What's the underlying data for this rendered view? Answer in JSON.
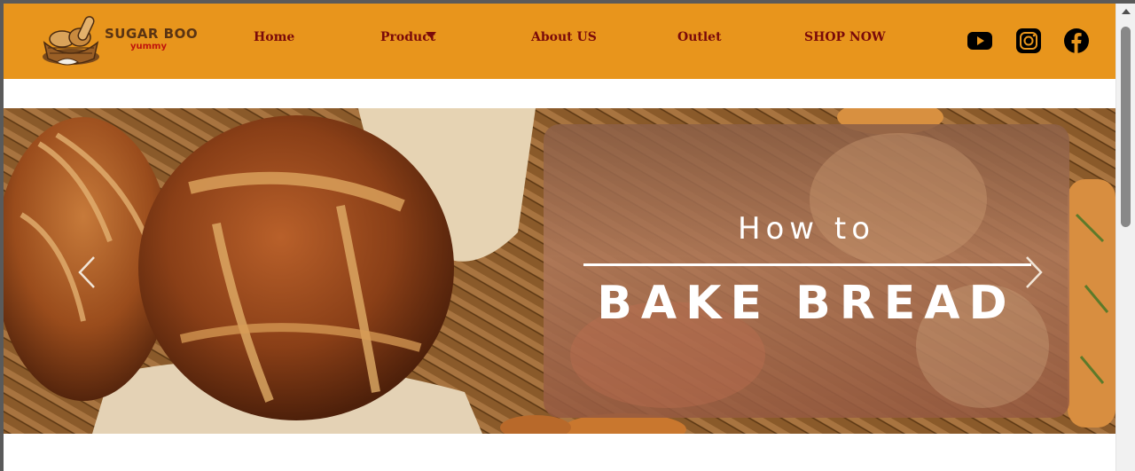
{
  "brand": {
    "name": "SUGAR BOO",
    "tagline": "yummy"
  },
  "nav": {
    "home": "Home",
    "product": "Product",
    "about": "About US",
    "outlet": "Outlet",
    "shop": "SHOP NOW"
  },
  "social": [
    "youtube-icon",
    "instagram-icon",
    "facebook-icon"
  ],
  "hero": {
    "line1": "How to",
    "line2": "BAKE BREAD",
    "prev_icon": "chevron-left-icon",
    "next_icon": "chevron-right-icon"
  },
  "colors": {
    "header_bg": "#e8951c",
    "nav_text": "#7a0a0a",
    "brand_text": "#5a3413",
    "tagline_text": "#c0140c"
  }
}
